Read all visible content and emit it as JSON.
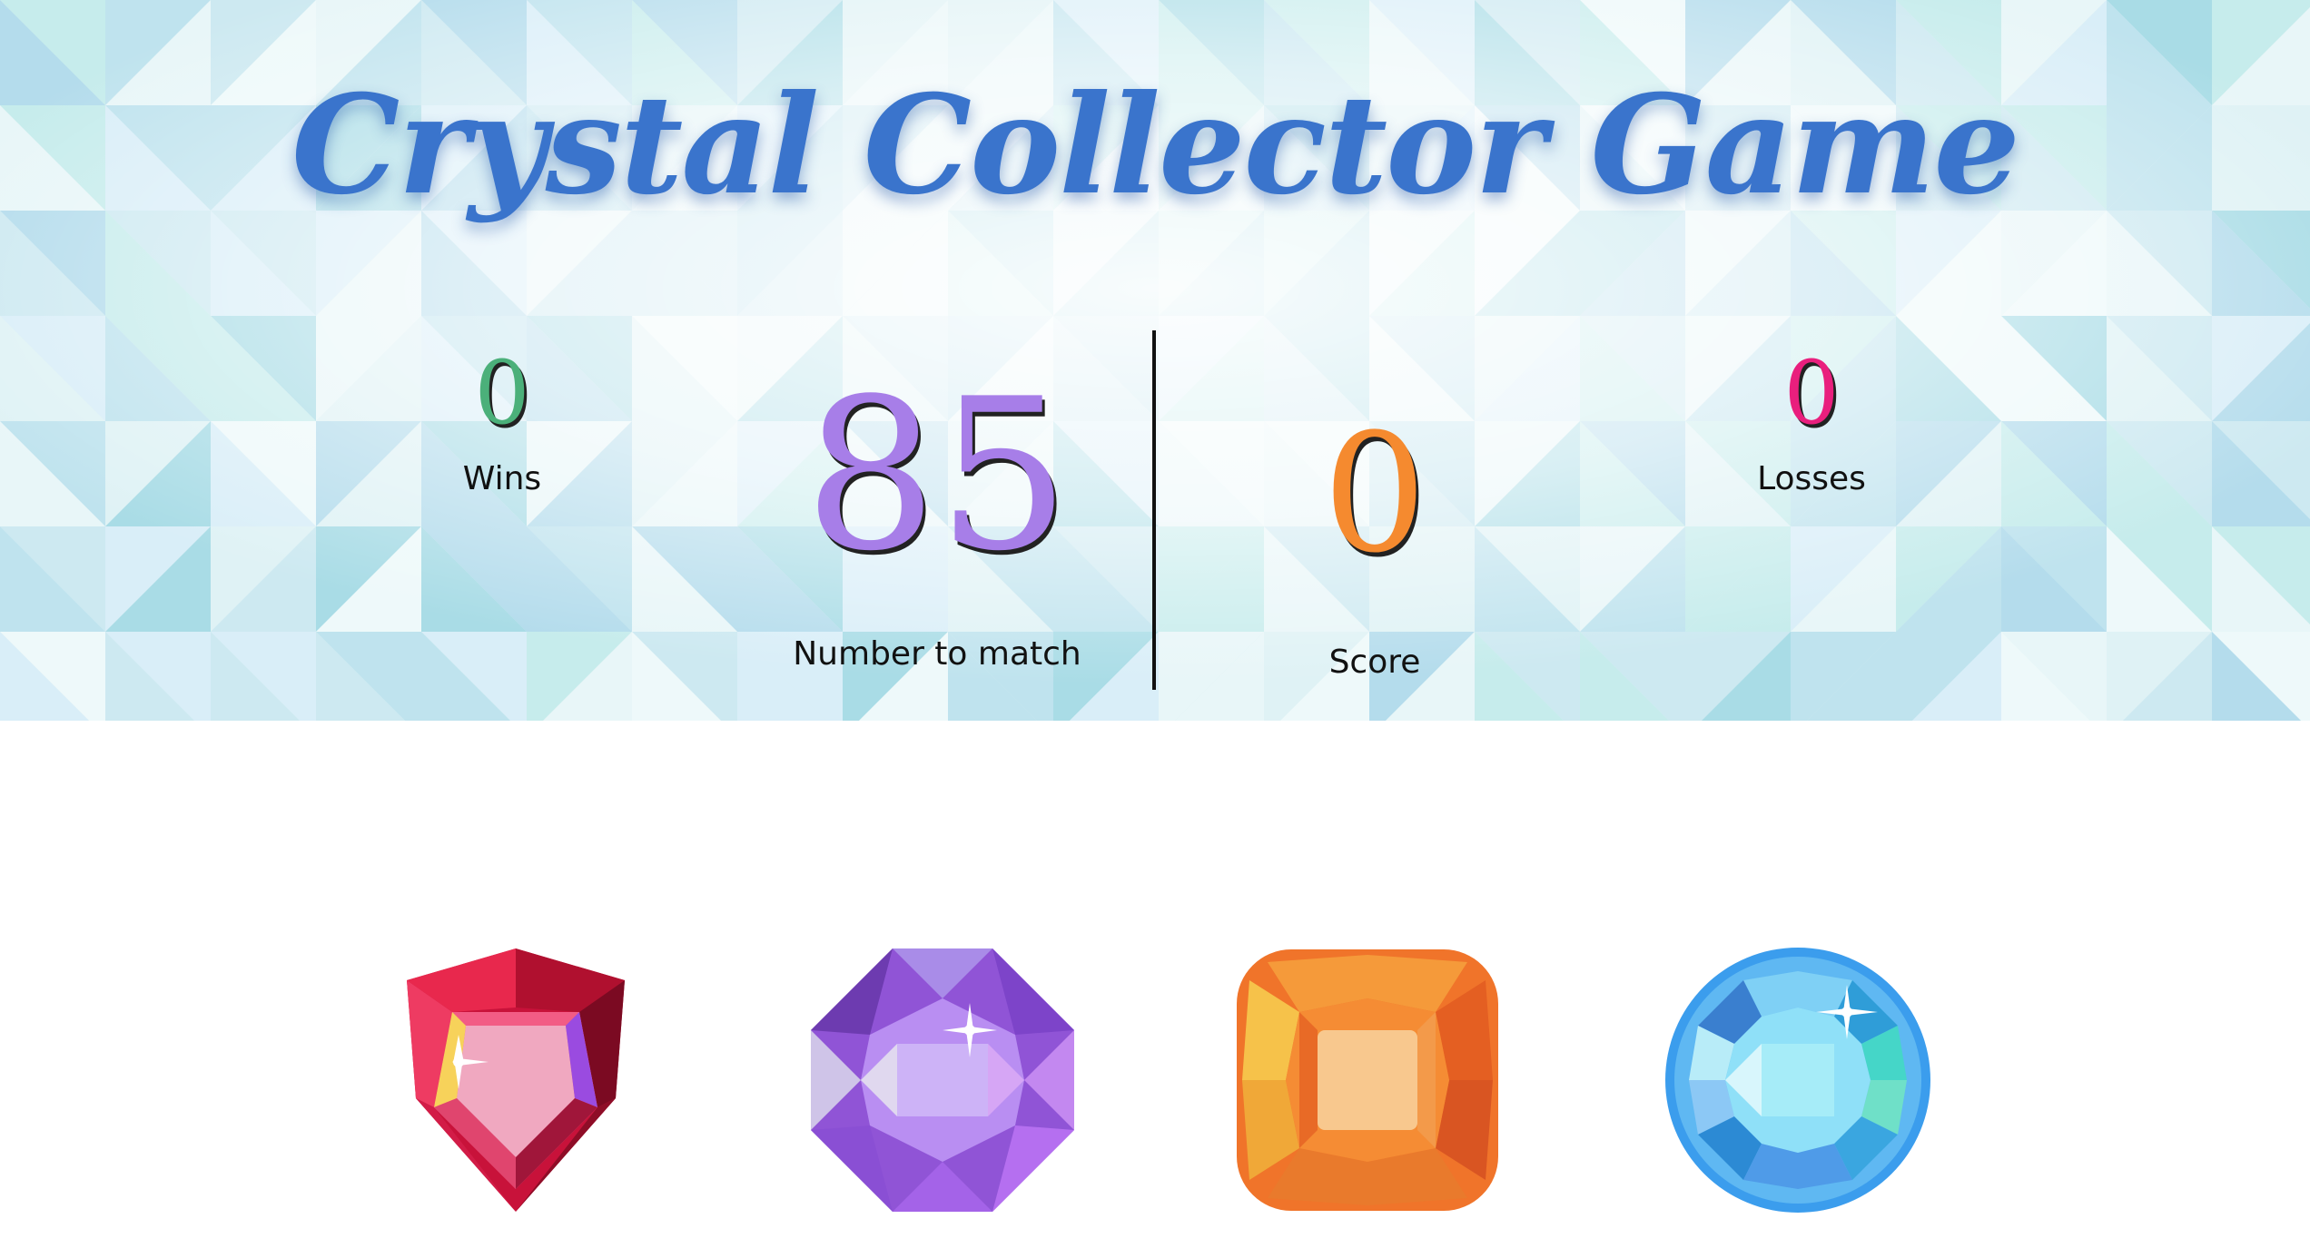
{
  "title": "Crystal Collector Game",
  "stats": {
    "wins": {
      "value": "0",
      "label": "Wins"
    },
    "target": {
      "value": "85",
      "label": "Number to match"
    },
    "score": {
      "value": "0",
      "label": "Score"
    },
    "losses": {
      "value": "0",
      "label": "Losses"
    }
  },
  "crystals": [
    {
      "name": "red-crystal",
      "icon": "red-trillion-gem-icon",
      "color": "#e8284d"
    },
    {
      "name": "purple-crystal",
      "icon": "purple-octagon-gem-icon",
      "color": "#a66de0"
    },
    {
      "name": "orange-crystal",
      "icon": "orange-cushion-gem-icon",
      "color": "#f5832a"
    },
    {
      "name": "blue-crystal",
      "icon": "blue-round-gem-icon",
      "color": "#3ba6ee"
    }
  ],
  "colors": {
    "title": "#3a74cc",
    "wins": "#4bb07a",
    "target": "#a77ee8",
    "score": "#f58a2f",
    "losses": "#e91f7d"
  }
}
